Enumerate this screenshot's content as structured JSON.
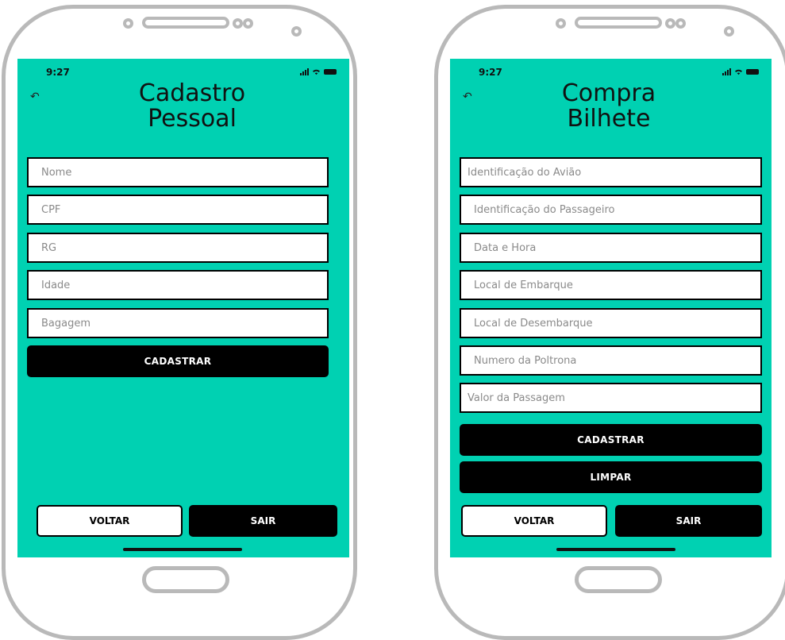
{
  "colors": {
    "screen_bg": "#00d1b2",
    "button_dark": "#000000",
    "frame": "#b9b9b9"
  },
  "status": {
    "time": "9:27",
    "icons": [
      "signal-icon",
      "wifi-icon",
      "battery-icon"
    ]
  },
  "screens": [
    {
      "title_line1": "Cadastro",
      "title_line2": "Pessoal",
      "fields": [
        "Nome",
        "CPF",
        "RG",
        "Idade",
        "Bagagem"
      ],
      "buttons": {
        "primary": "CADASTRAR",
        "back": "VOLTAR",
        "exit": "SAIR"
      }
    },
    {
      "title_line1": "Compra",
      "title_line2": "Bilhete",
      "fields": [
        "Identificação do Avião",
        "Identificação do Passageiro",
        "Data e Hora",
        "Local de Embarque",
        "Local de Desembarque",
        "Numero da Poltrona",
        "Valor da Passagem"
      ],
      "buttons": {
        "primary": "CADASTRAR",
        "clear": "LIMPAR",
        "back": "VOLTAR",
        "exit": "SAIR"
      }
    }
  ]
}
